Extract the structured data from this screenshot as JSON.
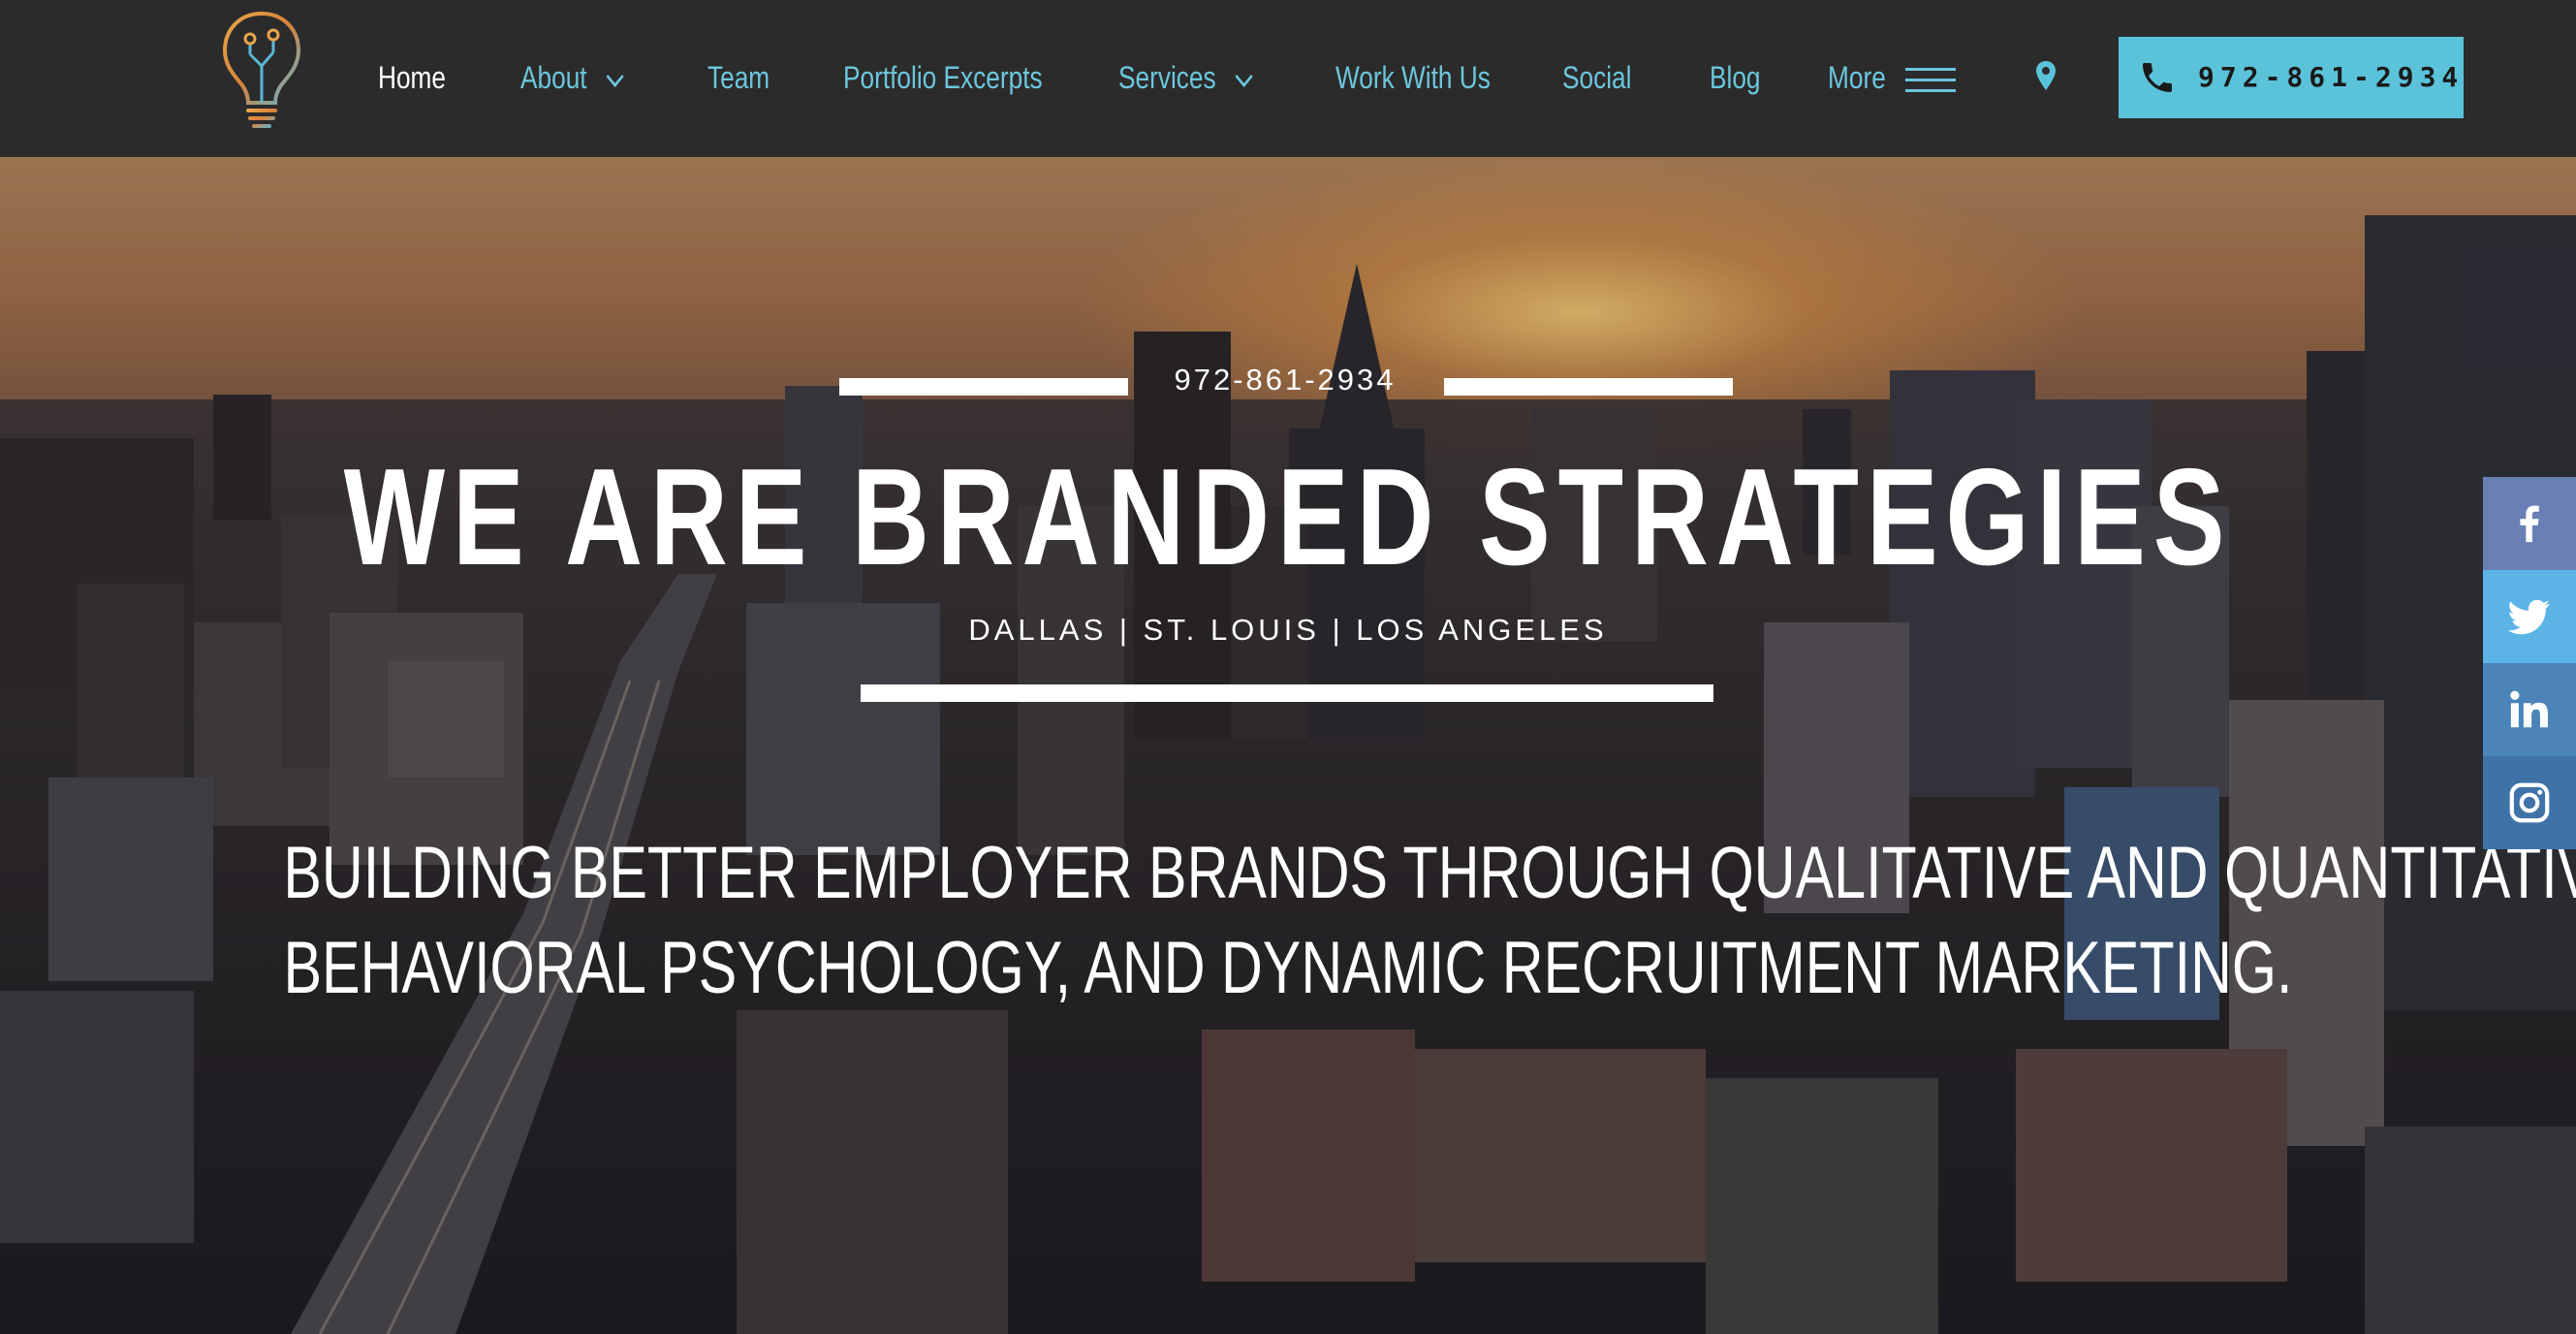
{
  "header": {
    "nav": [
      {
        "label": "Home",
        "active": true
      },
      {
        "label": "About",
        "dropdown": true
      },
      {
        "label": "Team"
      },
      {
        "label": "Portfolio Excerpts"
      },
      {
        "label": "Services",
        "dropdown": true
      },
      {
        "label": "Work With Us"
      },
      {
        "label": "Social"
      },
      {
        "label": "Blog"
      },
      {
        "label": "More"
      }
    ],
    "phone_button": "972-861-2934",
    "colors": {
      "bar": "#2b2b2b",
      "nav_link": "#6cc6dc",
      "active": "#ffffff",
      "phone_button_bg": "#5bc3d9"
    },
    "icons": [
      "lightbulb-logo-icon",
      "chevron-down-icon",
      "hamburger-menu-icon",
      "map-pin-icon",
      "phone-icon"
    ]
  },
  "hero": {
    "phone": "972-861-2934",
    "title": "WE ARE BRANDED STRATEGIES",
    "cities": "DALLAS | ST. LOUIS | LOS ANGELES",
    "tagline": [
      "BUILDING BETTER EMPLOYER BRANDS THROUGH QUALITATIVE AND QUANTITATIVE INSIGHTS,",
      "BEHAVIORAL PSYCHOLOGY, AND DYNAMIC RECRUITMENT MARKETING."
    ]
  },
  "social_bar": [
    {
      "network": "Facebook",
      "icon": "facebook-icon",
      "color": "#6a7fb5"
    },
    {
      "network": "Twitter",
      "icon": "twitter-icon",
      "color": "#5bb3e6"
    },
    {
      "network": "LinkedIn",
      "icon": "linkedin-icon",
      "color": "#4a84b8"
    },
    {
      "network": "Instagram",
      "icon": "instagram-icon",
      "color": "#3f73a8"
    }
  ]
}
